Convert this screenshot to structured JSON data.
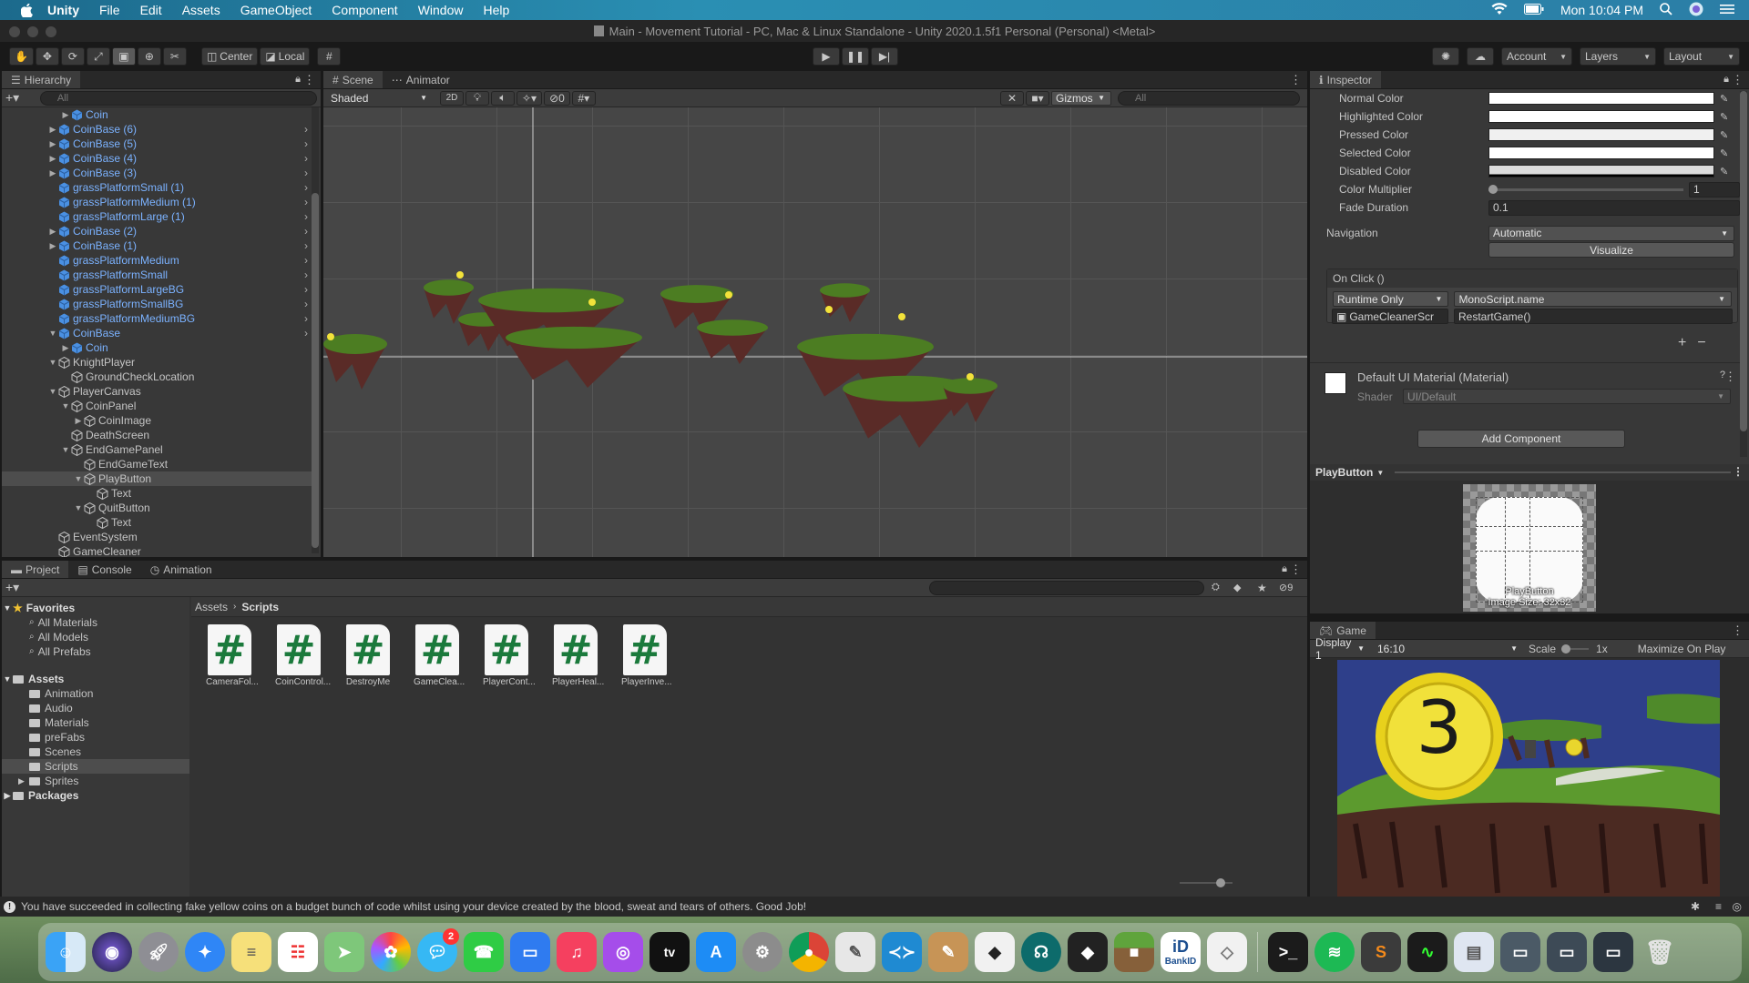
{
  "menubar": {
    "app": "Unity",
    "items": [
      "File",
      "Edit",
      "Assets",
      "GameObject",
      "Component",
      "Window",
      "Help"
    ],
    "clock": "Mon 10:04 PM"
  },
  "window_title": "Main - Movement Tutorial - PC, Mac & Linux Standalone - Unity 2020.1.5f1 Personal (Personal) <Metal>",
  "toolbar": {
    "pivot": "Center",
    "space": "Local",
    "account": "Account",
    "layers": "Layers",
    "layout": "Layout"
  },
  "hierarchy": {
    "title": "Hierarchy",
    "search_placeholder": "All",
    "rows": [
      {
        "label": "Coin",
        "depth": 2,
        "prefab": true,
        "arrow": "▶",
        "chev": false
      },
      {
        "label": "CoinBase (6)",
        "depth": 1,
        "prefab": true,
        "arrow": "▶",
        "chev": true
      },
      {
        "label": "CoinBase (5)",
        "depth": 1,
        "prefab": true,
        "arrow": "▶",
        "chev": true
      },
      {
        "label": "CoinBase (4)",
        "depth": 1,
        "prefab": true,
        "arrow": "▶",
        "chev": true
      },
      {
        "label": "CoinBase (3)",
        "depth": 1,
        "prefab": true,
        "arrow": "▶",
        "chev": true
      },
      {
        "label": "grassPlatformSmall (1)",
        "depth": 1,
        "prefab": true,
        "arrow": "",
        "chev": true
      },
      {
        "label": "grassPlatformMedium (1)",
        "depth": 1,
        "prefab": true,
        "arrow": "",
        "chev": true
      },
      {
        "label": "grassPlatformLarge (1)",
        "depth": 1,
        "prefab": true,
        "arrow": "",
        "chev": true
      },
      {
        "label": "CoinBase (2)",
        "depth": 1,
        "prefab": true,
        "arrow": "▶",
        "chev": true
      },
      {
        "label": "CoinBase (1)",
        "depth": 1,
        "prefab": true,
        "arrow": "▶",
        "chev": true
      },
      {
        "label": "grassPlatformMedium",
        "depth": 1,
        "prefab": true,
        "arrow": "",
        "chev": true
      },
      {
        "label": "grassPlatformSmall",
        "depth": 1,
        "prefab": true,
        "arrow": "",
        "chev": true
      },
      {
        "label": "grassPlatformLargeBG",
        "depth": 1,
        "prefab": true,
        "arrow": "",
        "chev": true
      },
      {
        "label": "grassPlatformSmallBG",
        "depth": 1,
        "prefab": true,
        "arrow": "",
        "chev": true
      },
      {
        "label": "grassPlatformMediumBG",
        "depth": 1,
        "prefab": true,
        "arrow": "",
        "chev": true
      },
      {
        "label": "CoinBase",
        "depth": 1,
        "prefab": true,
        "arrow": "▼",
        "chev": true
      },
      {
        "label": "Coin",
        "depth": 2,
        "prefab": true,
        "arrow": "▶",
        "chev": false
      },
      {
        "label": "KnightPlayer",
        "depth": 1,
        "prefab": false,
        "arrow": "▼",
        "chev": false
      },
      {
        "label": "GroundCheckLocation",
        "depth": 2,
        "prefab": false,
        "arrow": "",
        "chev": false
      },
      {
        "label": "PlayerCanvas",
        "depth": 1,
        "prefab": false,
        "arrow": "▼",
        "chev": false
      },
      {
        "label": "CoinPanel",
        "depth": 2,
        "prefab": false,
        "arrow": "▼",
        "chev": false
      },
      {
        "label": "CoinImage",
        "depth": 3,
        "prefab": false,
        "arrow": "▶",
        "chev": false
      },
      {
        "label": "DeathScreen",
        "depth": 2,
        "prefab": false,
        "arrow": "",
        "chev": false
      },
      {
        "label": "EndGamePanel",
        "depth": 2,
        "prefab": false,
        "arrow": "▼",
        "chev": false
      },
      {
        "label": "EndGameText",
        "depth": 3,
        "prefab": false,
        "arrow": "",
        "chev": false
      },
      {
        "label": "PlayButton",
        "depth": 3,
        "prefab": false,
        "arrow": "▼",
        "chev": false,
        "selected": true
      },
      {
        "label": "Text",
        "depth": 4,
        "prefab": false,
        "arrow": "",
        "chev": false
      },
      {
        "label": "QuitButton",
        "depth": 3,
        "prefab": false,
        "arrow": "▼",
        "chev": false
      },
      {
        "label": "Text",
        "depth": 4,
        "prefab": false,
        "arrow": "",
        "chev": false
      },
      {
        "label": "EventSystem",
        "depth": 1,
        "prefab": false,
        "arrow": "",
        "chev": false
      },
      {
        "label": "GameCleaner",
        "depth": 1,
        "prefab": false,
        "arrow": "",
        "chev": false
      }
    ]
  },
  "scene": {
    "tabs": [
      "Scene",
      "Animator"
    ],
    "shading": "Shaded",
    "mode_2d": "2D",
    "hidden_count": "0",
    "gizmos": "Gizmos",
    "search_placeholder": "All"
  },
  "inspector": {
    "title": "Inspector",
    "colors": [
      {
        "label": "Normal Color"
      },
      {
        "label": "Highlighted Color"
      },
      {
        "label": "Pressed Color"
      },
      {
        "label": "Selected Color"
      },
      {
        "label": "Disabled Color"
      }
    ],
    "color_multiplier_label": "Color Multiplier",
    "color_multiplier": "1",
    "fade_duration_label": "Fade Duration",
    "fade_duration": "0.1",
    "navigation_label": "Navigation",
    "navigation": "Automatic",
    "visualize": "Visualize",
    "onclick_label": "On Click ()",
    "runtime": "Runtime Only",
    "function": "MonoScript.name",
    "target": "GameCleanerScr",
    "method": "RestartGame()",
    "material": "Default UI Material (Material)",
    "shader_label": "Shader",
    "shader": "UI/Default",
    "add_component": "Add Component",
    "preview_title": "PlayButton",
    "preview_caption_1": "PlayButton",
    "preview_caption_2": "Image Size: 32x32"
  },
  "game": {
    "title": "Game",
    "display": "Display 1",
    "aspect": "16:10",
    "scale_label": "Scale",
    "scale": "1x",
    "maximize": "Maximize On Play",
    "countdown": "3"
  },
  "project": {
    "tabs": [
      "Project",
      "Console",
      "Animation"
    ],
    "hidden_count": "9",
    "breadcrumb": [
      "Assets",
      "Scripts"
    ],
    "favorites_label": "Favorites",
    "favorites": [
      "All Materials",
      "All Models",
      "All Prefabs"
    ],
    "assets_label": "Assets",
    "folders": [
      "Animation",
      "Audio",
      "Materials",
      "preFabs",
      "Scenes",
      "Scripts",
      "Sprites"
    ],
    "packages_label": "Packages",
    "scripts": [
      "CameraFol...",
      "CoinControl...",
      "DestroyMe",
      "GameClea...",
      "PlayerCont...",
      "PlayerHeal...",
      "PlayerInve..."
    ]
  },
  "status": "You have succeeded in collecting fake yellow coins on a budget bunch of code whilst using your device created by the blood, sweat and tears of others.  Good Job!",
  "dock": {
    "badge": "2",
    "tv": "tv",
    "bankid": "BankID"
  }
}
